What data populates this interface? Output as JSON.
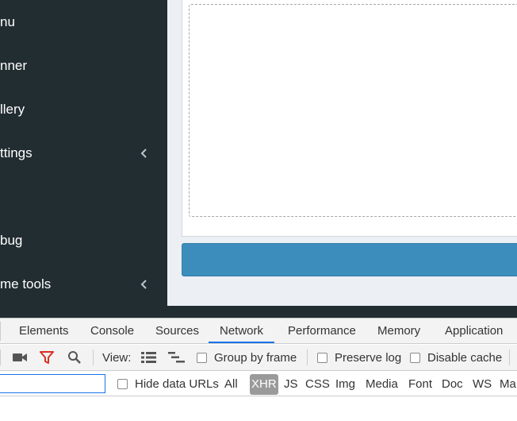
{
  "sidebar": {
    "items": [
      {
        "label": "nu",
        "chevron": false
      },
      {
        "label": "nner",
        "chevron": false
      },
      {
        "label": "llery",
        "chevron": false
      },
      {
        "label": "ttings",
        "chevron": true
      },
      {
        "label": "bug",
        "chevron": false
      },
      {
        "label": "me tools",
        "chevron": true
      }
    ]
  },
  "devtools": {
    "tabs": [
      "Elements",
      "Console",
      "Sources",
      "Network",
      "Performance",
      "Memory",
      "Application"
    ],
    "active_tab": "Network",
    "toolbar": {
      "view_label": "View:",
      "group_by_frame": "Group by frame",
      "preserve_log": "Preserve log",
      "disable_cache": "Disable cache"
    },
    "filter": {
      "value": "",
      "hide_data_urls": "Hide data URLs",
      "types": [
        "All",
        "XHR",
        "JS",
        "CSS",
        "Img",
        "Media",
        "Font",
        "Doc",
        "WS",
        "Ma"
      ],
      "active_type": "XHR"
    }
  },
  "colors": {
    "sidebar_bg": "#222d32",
    "content_bg": "#ecf0f5",
    "primary": "#3c8dbc",
    "record_icon": "#555555",
    "filter_icon": "#d93025",
    "devtools_active": "#1a73e8"
  }
}
